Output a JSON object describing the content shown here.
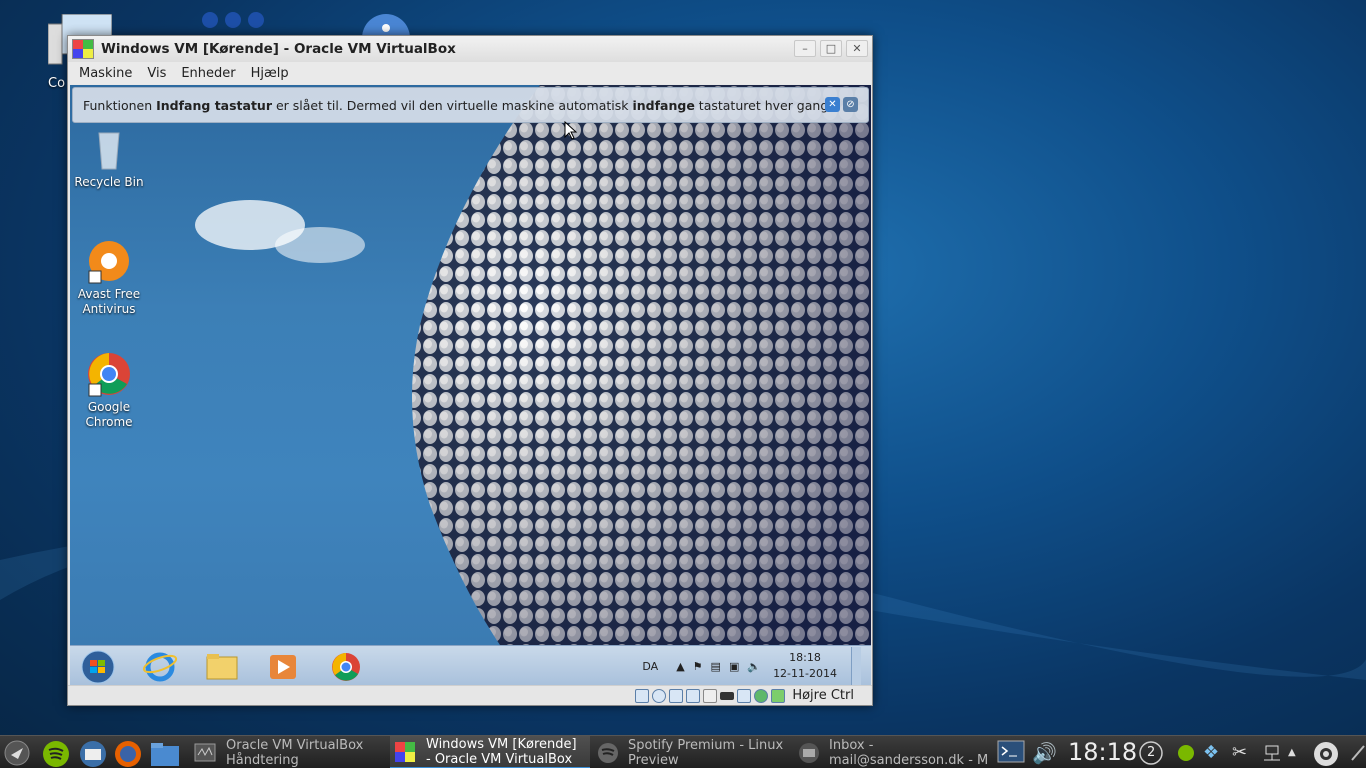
{
  "host_desktop": {
    "partial_icon_label": "Co"
  },
  "vm_window": {
    "title": "Windows VM [Kørende] - Oracle VM VirtualBox",
    "menu": [
      "Maskine",
      "Vis",
      "Enheder",
      "Hjælp"
    ],
    "notice": {
      "part1": "Funktionen ",
      "bold1": "Indfang tastatur",
      "part2": " er slået til. Dermed vil den virtuelle maskine automatisk ",
      "bold2": "indfange",
      "part3": " tastaturet hver gang"
    },
    "guest_icons": [
      {
        "label": "Recycle Bin"
      },
      {
        "label": "Avast Free Antivirus"
      },
      {
        "label": "Google Chrome"
      }
    ],
    "guest_taskbar": {
      "language": "DA",
      "time": "18:18",
      "date": "12-11-2014"
    },
    "status_bar": {
      "host_key": "Højre Ctrl"
    }
  },
  "host_panel": {
    "tasks": [
      {
        "label": "Oracle VM VirtualBox\nHåndtering"
      },
      {
        "label": "Windows VM [Kørende]\n- Oracle VM VirtualBox"
      },
      {
        "label": "Spotify Premium - Linux\nPreview"
      },
      {
        "label": "Inbox -\nmail@sandersson.dk - M"
      }
    ],
    "clock": "18:18",
    "workspace": "2"
  },
  "colors": {
    "host_bg": "#0f4f8a",
    "panel_bg": "#2a2a2a",
    "active_task_accent": "#3a8fd8"
  }
}
